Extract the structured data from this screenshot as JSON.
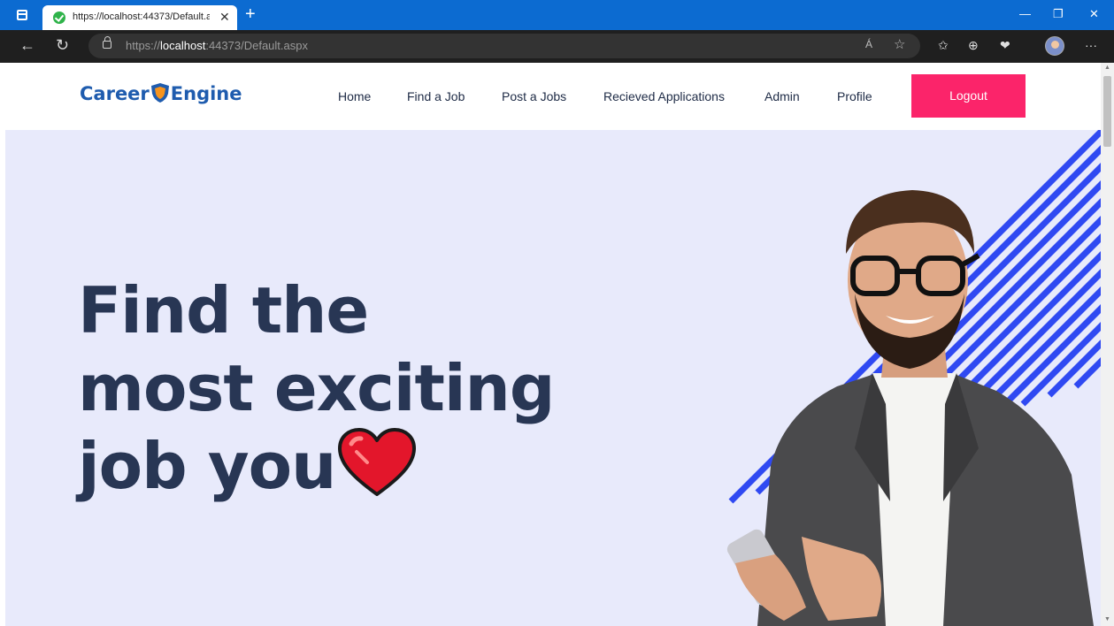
{
  "browser": {
    "tab_title": "https://localhost:44373/Default.a",
    "tab_close": "✕",
    "new_tab": "+",
    "url_prefix": "https://",
    "url_host": "localhost",
    "url_rest": ":44373/Default.aspx",
    "minimize": "—",
    "restore": "❐",
    "close": "✕",
    "back": "←",
    "refresh": "↻",
    "read_aloud": "Á",
    "favorite": "☆",
    "favorites": "✩",
    "collections": "⊕",
    "health": "❤",
    "more": "···"
  },
  "site": {
    "logo_left": "Career",
    "logo_right": "Engine",
    "nav": {
      "home": "Home",
      "find_job": "Find a Job",
      "post_jobs": "Post a Jobs",
      "applications": "Recieved Applications",
      "admin": "Admin",
      "profile": "Profile"
    },
    "logout": "Logout"
  },
  "hero": {
    "line1": "Find the",
    "line2": "most exciting",
    "line3": "job you"
  },
  "colors": {
    "accent": "#fb246a",
    "brand": "#1f5cae",
    "hero_bg": "#e8eafb",
    "stripe": "#2f49f2",
    "heading": "#283654"
  },
  "icons": [
    "window-icon",
    "secure-check-icon",
    "lock-icon",
    "read-aloud-icon",
    "favorite-icon",
    "favorites-icon",
    "collections-icon",
    "health-icon",
    "profile-avatar",
    "more-icon",
    "heart-icon",
    "shield-logo-icon"
  ]
}
